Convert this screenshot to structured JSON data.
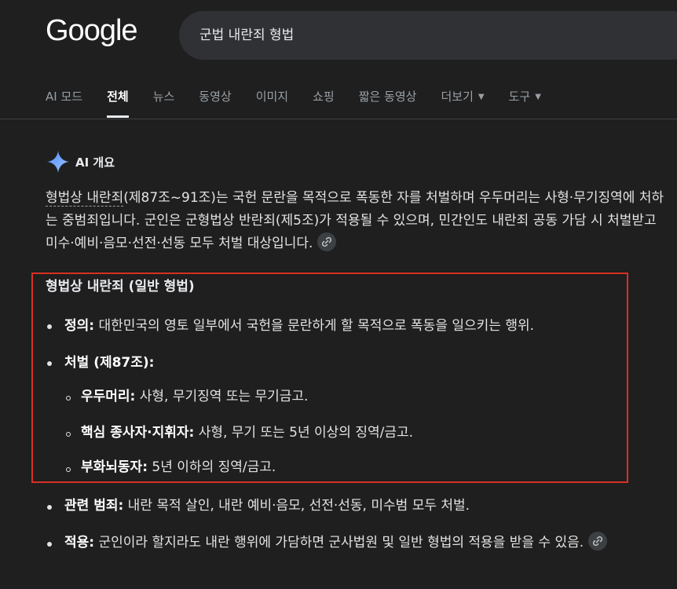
{
  "header": {
    "logo": "Google",
    "search_value": "군법 내란죄 형법"
  },
  "tabs": [
    {
      "label": "AI 모드"
    },
    {
      "label": "전체",
      "active": true
    },
    {
      "label": "뉴스"
    },
    {
      "label": "동영상"
    },
    {
      "label": "이미지"
    },
    {
      "label": "쇼핑"
    },
    {
      "label": "짧은 동영상"
    },
    {
      "label": "더보기"
    },
    {
      "label": "도구"
    }
  ],
  "overview": {
    "title": "AI 개요",
    "intro_link": "형법상 내란죄",
    "intro_rest": "(제87조~91조)는 국헌 문란을 목적으로 폭동한 자를 처벌하며 우두머리는 사형·무기징역에 처하는 중범죄입니다. 군인은 군형법상 반란죄(제5조)가 적용될 수 있으며, 민간인도 내란죄 공동 가담 시 처벌받고 미수·예비·음모·선전·선동 모두 처벌 대상입니다."
  },
  "section": {
    "title": "형법상 내란죄 (일반 형법)",
    "definition": {
      "label": "정의:",
      "text": " 대한민국의 영토 일부에서 국헌을 문란하게 할 목적으로 폭동을 일으키는 행위."
    },
    "punishment": {
      "label": "처벌 (제87조):"
    },
    "sub": [
      {
        "label": "우두머리:",
        "text": " 사형, 무기징역 또는 무기금고."
      },
      {
        "label": "핵심 종사자·지휘자:",
        "text": " 사형, 무기 또는 5년 이상의 징역/금고."
      },
      {
        "label": "부화뇌동자:",
        "text": " 5년 이하의 징역/금고."
      }
    ],
    "related": {
      "label": "관련 범죄:",
      "text": " 내란 목적 살인, 내란 예비·음모, 선전·선동, 미수범 모두 처벌."
    },
    "apply": {
      "label": "적용:",
      "text": " 군인이라 할지라도 내란 행위에 가담하면 군사법원 및 일반 형법의 적용을 받을 수 있음."
    }
  },
  "colors": {
    "accent_box": "#d93025",
    "background": "#1f1f1f"
  }
}
